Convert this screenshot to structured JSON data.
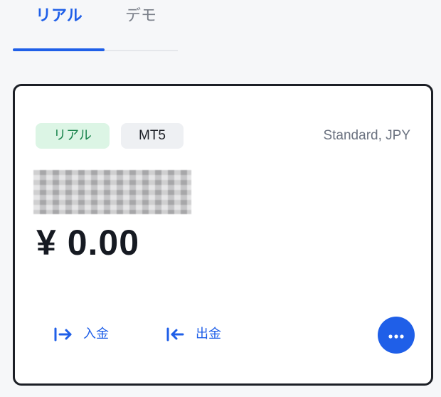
{
  "tabs": [
    {
      "label": "リアル",
      "active": true
    },
    {
      "label": "デモ",
      "active": false
    }
  ],
  "account_card": {
    "badges": {
      "type": "リアル",
      "platform": "MT5"
    },
    "account_type": "Standard, JPY",
    "account_number_masked": true,
    "balance": "¥ 0.00",
    "actions": {
      "deposit": {
        "label": "入金",
        "icon": "deposit-arrow-icon"
      },
      "withdraw": {
        "label": "出金",
        "icon": "withdraw-arrow-icon"
      },
      "more": {
        "icon": "more-dots-icon"
      }
    }
  },
  "colors": {
    "accent": "#1f5fe8",
    "badge_real_bg": "#dcf5e5",
    "badge_real_text": "#17834a"
  }
}
